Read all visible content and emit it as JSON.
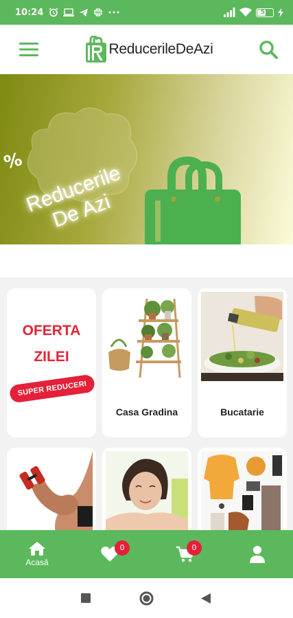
{
  "status_bar": {
    "time": "10:24",
    "battery_level": "57",
    "battery_fraction": 0.57,
    "icons": [
      "alarm-icon",
      "laptop-icon",
      "telegram-icon",
      "basketball-icon",
      "more-dots-icon",
      "signal-icon",
      "wifi-icon",
      "battery-icon",
      "charging-icon"
    ]
  },
  "app_bar": {
    "logo_text": "ReducerileDeAzi",
    "menu_icon": "hamburger-menu-icon",
    "search_icon": "search-icon"
  },
  "banner": {
    "percent_symbol": "%",
    "line1": "Reducerile",
    "line2": "De Azi"
  },
  "offer_card": {
    "line1": "OFERTA",
    "line2": "ZILEI",
    "badge": "SUPER REDUCERI"
  },
  "categories": [
    {
      "label": "Casa Gradina",
      "image": "plant-shelf-image"
    },
    {
      "label": "Bucatarie",
      "image": "salad-oil-image"
    },
    {
      "label": "",
      "image": "dumbbell-arm-image"
    },
    {
      "label": "",
      "image": "woman-face-image"
    },
    {
      "label": "",
      "image": "fashion-items-image"
    }
  ],
  "bottom_nav": {
    "home_label": "Acasă",
    "favorites_count": "0",
    "cart_count": "0"
  },
  "colors": {
    "brand_green": "#5cb85c",
    "badge_red": "#e4203a",
    "offer_red": "#e42438"
  }
}
